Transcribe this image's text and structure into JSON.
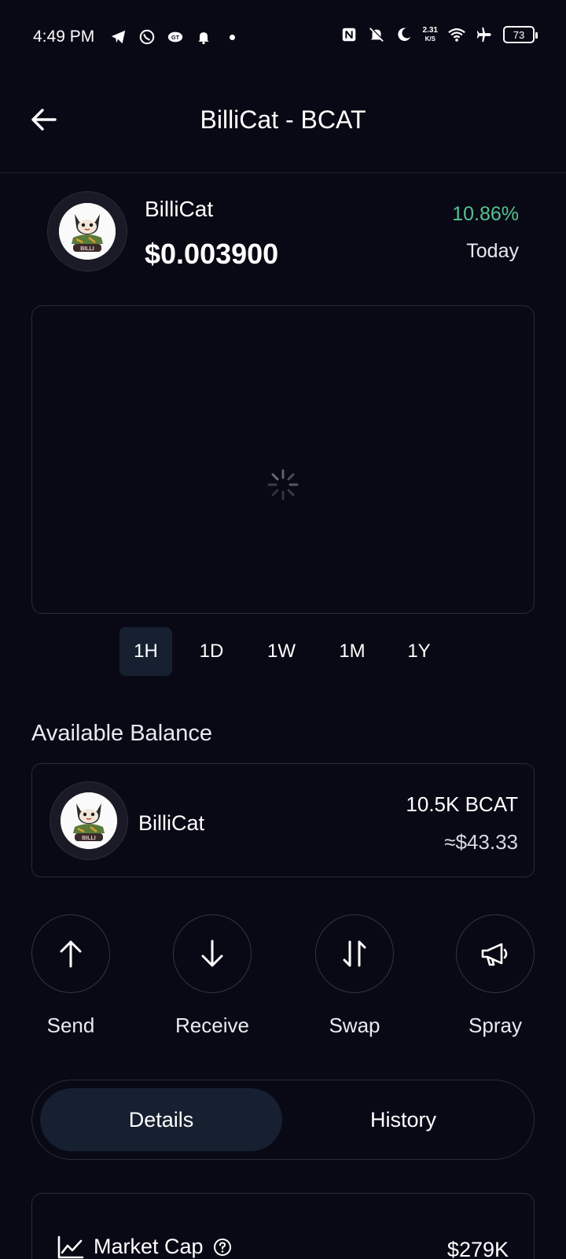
{
  "status_bar": {
    "time": "4:49 PM",
    "net_speed_value": "2.31",
    "net_speed_unit": "K/S",
    "battery": "73"
  },
  "header": {
    "title": "BilliCat - BCAT"
  },
  "token": {
    "name": "BilliCat",
    "price": "$0.003900",
    "change": "10.86%",
    "period": "Today",
    "change_color": "#57c28f"
  },
  "chart": {
    "loading": true,
    "ranges": [
      {
        "label": "1H",
        "active": true
      },
      {
        "label": "1D",
        "active": false
      },
      {
        "label": "1W",
        "active": false
      },
      {
        "label": "1M",
        "active": false
      },
      {
        "label": "1Y",
        "active": false
      }
    ]
  },
  "balance": {
    "heading": "Available Balance",
    "token_name": "BilliCat",
    "amount": "10.5K BCAT",
    "fiat": "≈$43.33"
  },
  "actions": [
    {
      "label": "Send",
      "icon": "arrow-up-icon"
    },
    {
      "label": "Receive",
      "icon": "arrow-down-icon"
    },
    {
      "label": "Swap",
      "icon": "swap-icon"
    },
    {
      "label": "Spray",
      "icon": "megaphone-icon"
    }
  ],
  "tabs": [
    {
      "label": "Details",
      "active": true
    },
    {
      "label": "History",
      "active": false
    }
  ],
  "details": {
    "market_cap_label": "Market Cap",
    "market_cap_value": "$279K"
  },
  "colors": {
    "background": "#090915",
    "active_tab": "#172030",
    "positive": "#57c28f"
  }
}
